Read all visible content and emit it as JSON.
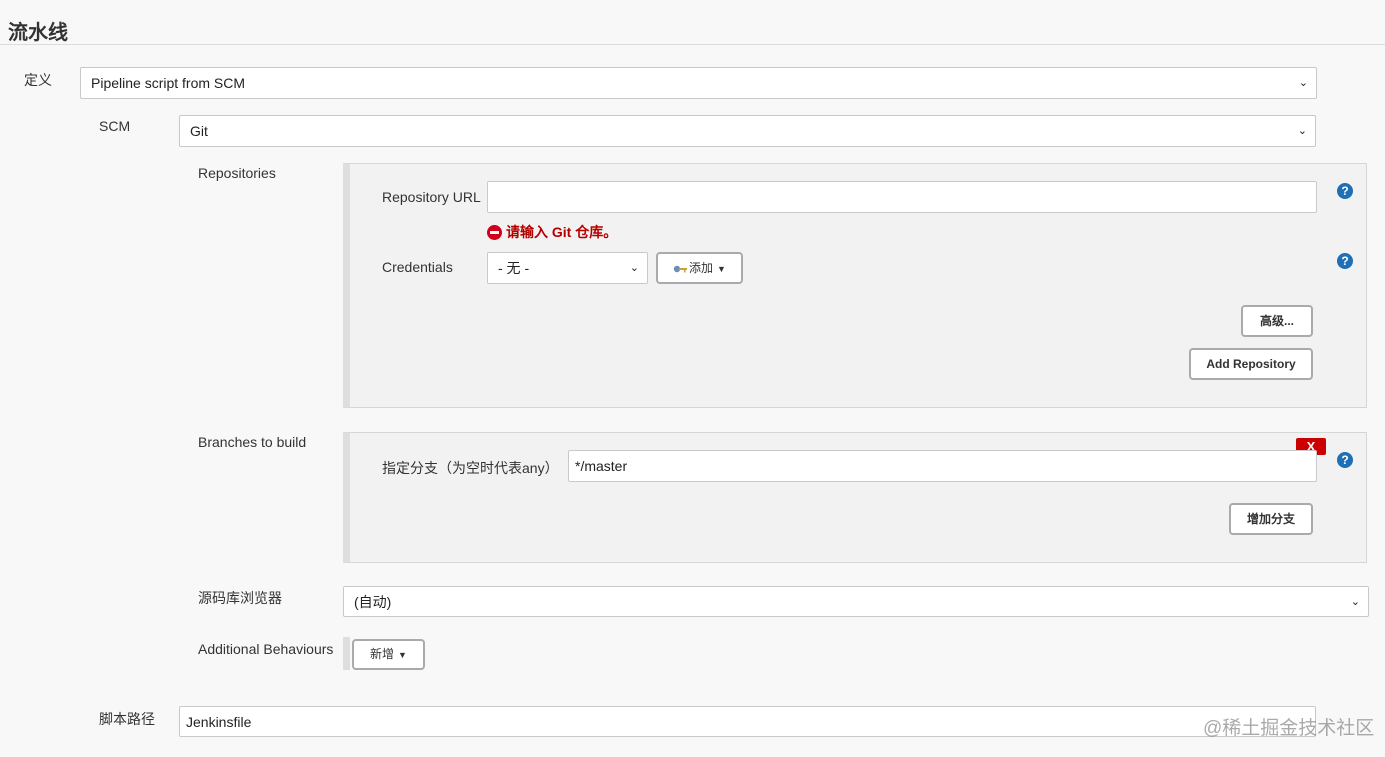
{
  "section": {
    "title": "流水线"
  },
  "definition": {
    "label": "定义",
    "value": "Pipeline script from SCM"
  },
  "scm": {
    "label": "SCM",
    "value": "Git"
  },
  "repositories": {
    "label": "Repositories",
    "url_label": "Repository URL",
    "url_value": "",
    "error": "请输入 Git 仓库。",
    "credentials_label": "Credentials",
    "credentials_value": "- 无 -",
    "add_label": "添加",
    "advanced_label": "高级...",
    "add_repository_label": "Add Repository"
  },
  "branches": {
    "label": "Branches to build",
    "branch_label": "指定分支（为空时代表any）",
    "branch_value": "*/master",
    "delete_label": "X",
    "add_branch_label": "增加分支"
  },
  "browser": {
    "label": "源码库浏览器",
    "value": "(自动)"
  },
  "behaviours": {
    "label": "Additional Behaviours",
    "add_label": "新增"
  },
  "script_path": {
    "label": "脚本路径",
    "value": "Jenkinsfile"
  },
  "help_symbol": "?",
  "dropdown_symbol": "⌄",
  "caret_symbol": "▼",
  "watermark": "@稀土掘金技术社区",
  "colors": {
    "error": "#b50000",
    "help": "#1f6fb5",
    "delete": "#cc0000"
  }
}
